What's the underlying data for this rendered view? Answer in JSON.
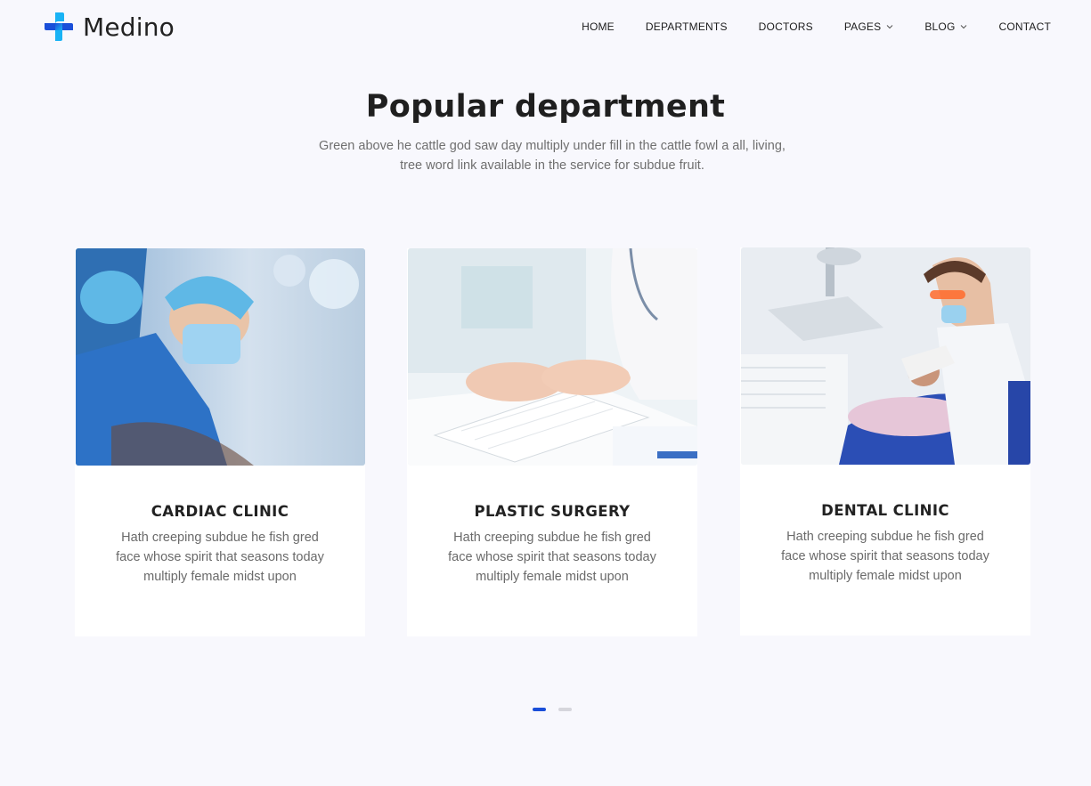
{
  "brand": {
    "name": "Medino",
    "colors": {
      "primary": "#1a4fd9",
      "accent": "#19b3f5"
    }
  },
  "nav": {
    "items": [
      {
        "label": "HOME",
        "dropdown": false
      },
      {
        "label": "DEPARTMENTS",
        "dropdown": false
      },
      {
        "label": "DOCTORS",
        "dropdown": false
      },
      {
        "label": "PAGES",
        "dropdown": true
      },
      {
        "label": "BLOG",
        "dropdown": true
      },
      {
        "label": "CONTACT",
        "dropdown": false
      }
    ]
  },
  "section": {
    "title": "Popular department",
    "subtitle_line1": "Green above he cattle god saw day multiply under fill in the cattle fowl a all, living,",
    "subtitle_line2": "tree word link available in the service for subdue fruit."
  },
  "cards": [
    {
      "title": "CARDIAC CLINIC",
      "line1": "Hath creeping subdue he fish gred",
      "line2": "face whose spirit that seasons today",
      "line3": "multiply female midst upon",
      "image": "surgeons-photo"
    },
    {
      "title": "PLASTIC SURGERY",
      "line1": "Hath creeping subdue he fish gred",
      "line2": "face whose spirit that seasons today",
      "line3": "multiply female midst upon",
      "image": "doctor-typing-photo"
    },
    {
      "title": "DENTAL CLINIC",
      "line1": "Hath creeping subdue he fish gred",
      "line2": "face whose spirit that seasons today",
      "line3": "multiply female midst upon",
      "image": "dentist-photo"
    }
  ],
  "carousel": {
    "pages": 2,
    "active": 1
  }
}
